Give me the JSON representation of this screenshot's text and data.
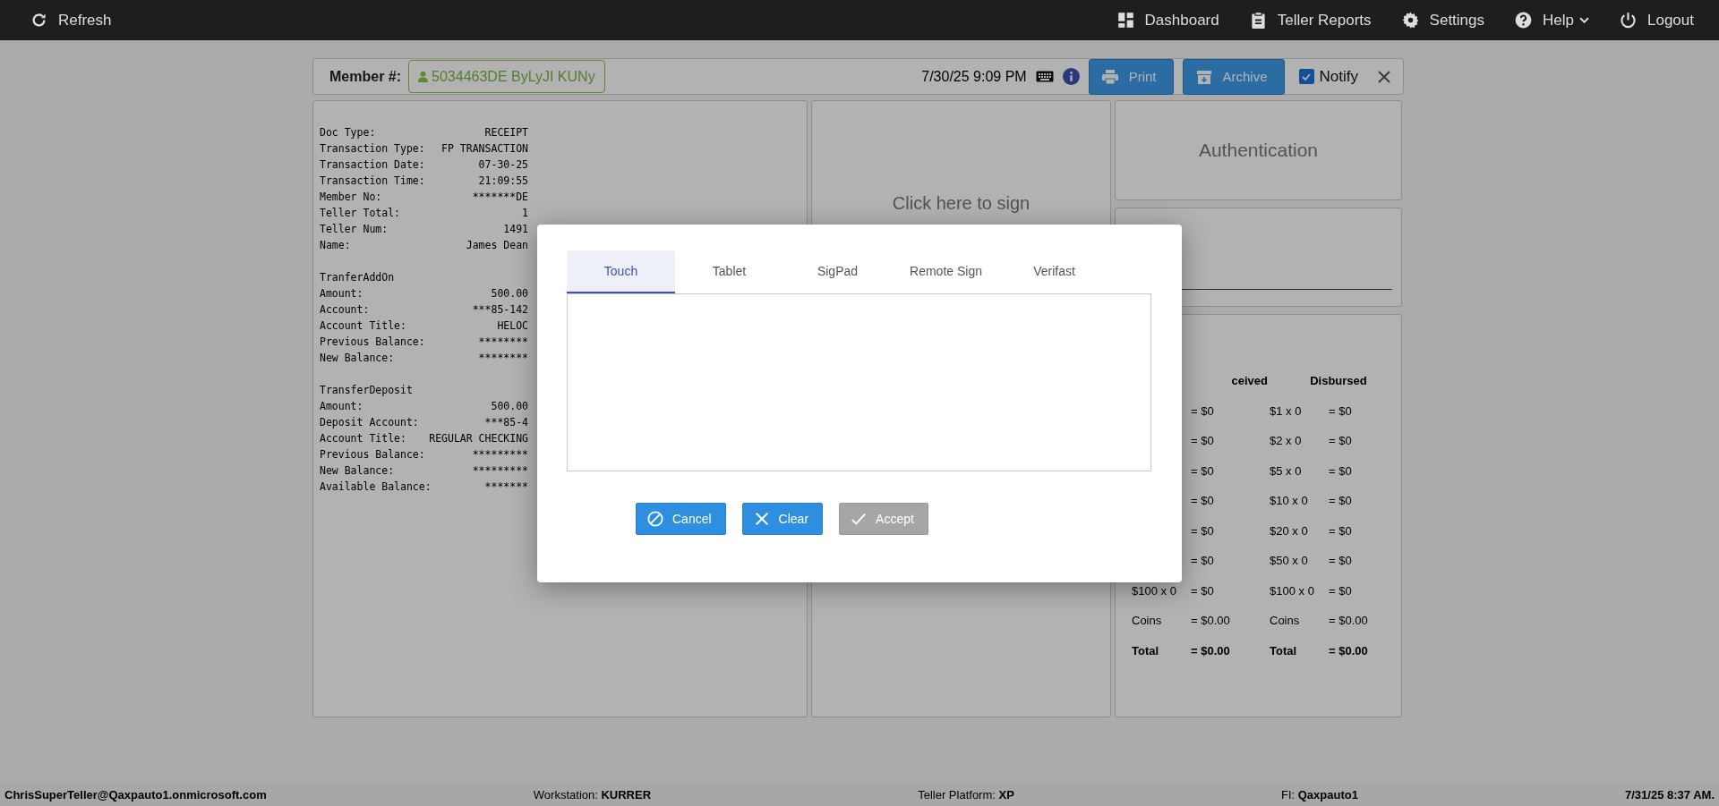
{
  "nav": {
    "left": [
      {
        "kind": "refresh",
        "label": "Refresh"
      }
    ],
    "right": [
      {
        "kind": "dashboard",
        "label": "Dashboard",
        "dropdown": false
      },
      {
        "kind": "reports",
        "label": "Teller Reports",
        "dropdown": false
      },
      {
        "kind": "settings",
        "label": "Settings",
        "dropdown": false
      },
      {
        "kind": "help",
        "label": "Help",
        "dropdown": true
      },
      {
        "kind": "logout",
        "label": "Logout",
        "dropdown": false
      }
    ]
  },
  "member_bar": {
    "label": "Member #:",
    "member": "5034463DE ByLyJI KUNy",
    "datetime": "7/30/25 9:09 PM",
    "print": "Print",
    "archive": "Archive",
    "notify": {
      "label": "Notify",
      "checked": true
    }
  },
  "receipt": [
    {
      "kind": "field",
      "label": "Doc Type:",
      "value": "RECEIPT"
    },
    {
      "kind": "field",
      "label": "Transaction Type:",
      "value": "FP TRANSACTION"
    },
    {
      "kind": "field",
      "label": "Transaction Date:",
      "value": "07-30-25"
    },
    {
      "kind": "field",
      "label": "Transaction Time:",
      "value": "21:09:55"
    },
    {
      "kind": "field",
      "label": "Member No:",
      "value": "*******DE"
    },
    {
      "kind": "field",
      "label": "Teller Total:",
      "value": "1"
    },
    {
      "kind": "field",
      "label": "Teller Num:",
      "value": "1491"
    },
    {
      "kind": "field",
      "label": "Name:",
      "value": "James Dean"
    },
    {
      "kind": "blank"
    },
    {
      "kind": "heading",
      "label": "TranferAddOn"
    },
    {
      "kind": "field",
      "label": "Amount:",
      "value": "500.00"
    },
    {
      "kind": "field",
      "label": "Account:",
      "value": "***85-142"
    },
    {
      "kind": "field",
      "label": "Account Title:",
      "value": "HELOC"
    },
    {
      "kind": "field",
      "label": "Previous Balance:",
      "value": "********"
    },
    {
      "kind": "field",
      "label": "New Balance:",
      "value": "********"
    },
    {
      "kind": "blank"
    },
    {
      "kind": "heading",
      "label": "TransferDeposit"
    },
    {
      "kind": "field",
      "label": "Amount:",
      "value": "500.00"
    },
    {
      "kind": "field",
      "label": "Deposit Account:",
      "value": "***85-4"
    },
    {
      "kind": "field",
      "label": "Account Title:",
      "value": "REGULAR CHECKING"
    },
    {
      "kind": "field",
      "label": "Previous Balance:",
      "value": "*********"
    },
    {
      "kind": "field",
      "label": "New Balance:",
      "value": "*********"
    },
    {
      "kind": "field",
      "label": "Available Balance:",
      "value": "*******"
    }
  ],
  "sign_panel": {
    "prompt": "Click here to sign"
  },
  "auth_panel": {
    "title": "Authentication"
  },
  "cash": {
    "received_header": "ceived",
    "disbursed_header": "Disbursed",
    "received": [
      {
        "kind": "row",
        "amount": "= $0"
      },
      {
        "kind": "row",
        "amount": "= $0"
      },
      {
        "kind": "row",
        "amount": "= $0"
      },
      {
        "kind": "row",
        "amount": "= $0"
      },
      {
        "kind": "row",
        "amount": "= $0"
      },
      {
        "kind": "row",
        "amount": "= $0"
      },
      {
        "kind": "row",
        "denomination": "$100 x 0",
        "amount": "= $0"
      },
      {
        "kind": "row",
        "denomination": "Coins",
        "amount": "= $0.00"
      },
      {
        "kind": "total",
        "denomination": "Total",
        "amount": "= $0.00"
      }
    ],
    "disbursed": [
      {
        "kind": "row",
        "denomination": "$1 x 0",
        "amount": "= $0"
      },
      {
        "kind": "row",
        "denomination": "$2 x 0",
        "amount": "= $0"
      },
      {
        "kind": "row",
        "denomination": "$5 x 0",
        "amount": "= $0"
      },
      {
        "kind": "row",
        "denomination": "$10 x 0",
        "amount": "= $0"
      },
      {
        "kind": "row",
        "denomination": "$20 x 0",
        "amount": "= $0"
      },
      {
        "kind": "row",
        "denomination": "$50 x 0",
        "amount": "= $0"
      },
      {
        "kind": "row",
        "denomination": "$100 x 0",
        "amount": "= $0"
      },
      {
        "kind": "row",
        "denomination": "Coins",
        "amount": "= $0.00"
      },
      {
        "kind": "total",
        "denomination": "Total",
        "amount": "= $0.00"
      }
    ]
  },
  "modal": {
    "tabs": [
      {
        "label": "Touch",
        "selected": true
      },
      {
        "label": "Tablet",
        "selected": false
      },
      {
        "label": "SigPad",
        "selected": false
      },
      {
        "label": "Remote Sign",
        "selected": false
      },
      {
        "label": "Verifast",
        "selected": false
      }
    ],
    "buttons": [
      {
        "kind": "cancel",
        "label": "Cancel",
        "disabled": false
      },
      {
        "kind": "clear",
        "label": "Clear",
        "disabled": false
      },
      {
        "kind": "accept",
        "label": "Accept",
        "disabled": true
      }
    ]
  },
  "status_bar": [
    {
      "value": "ChrisSuperTeller@Qaxpauto1.onmicrosoft.com"
    },
    {
      "label": "Workstation:",
      "value": "KURRER"
    },
    {
      "label": "Teller Platform:",
      "value": "XP"
    },
    {
      "label": "FI:",
      "value": "Qaxpauto1"
    },
    {
      "value": "7/31/25 8:37 AM."
    }
  ]
}
